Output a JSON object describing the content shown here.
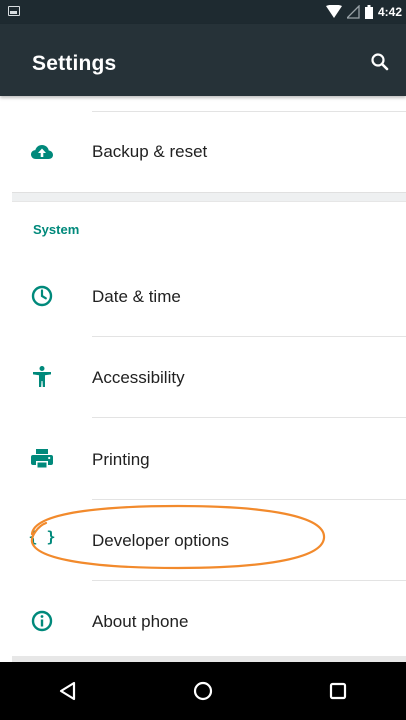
{
  "status_bar": {
    "time": "4:42"
  },
  "app_bar": {
    "title": "Settings"
  },
  "icons": {
    "search": "search-icon",
    "back": "back-icon",
    "home": "home-icon",
    "recents": "recents-icon"
  },
  "sections": [
    {
      "items": [
        {
          "label": "Backup & reset",
          "icon": "backup-icon"
        }
      ]
    },
    {
      "header": "System",
      "items": [
        {
          "label": "Date & time",
          "icon": "clock-icon"
        },
        {
          "label": "Accessibility",
          "icon": "accessibility-icon"
        },
        {
          "label": "Printing",
          "icon": "printer-icon"
        },
        {
          "label": "Developer options",
          "icon": "braces-icon",
          "highlighted": true
        },
        {
          "label": "About phone",
          "icon": "info-icon"
        }
      ]
    }
  ],
  "colors": {
    "app_bar": "#263238",
    "status_bar": "#1e2a30",
    "accent": "#00897b",
    "highlight": "#f28a2c"
  }
}
